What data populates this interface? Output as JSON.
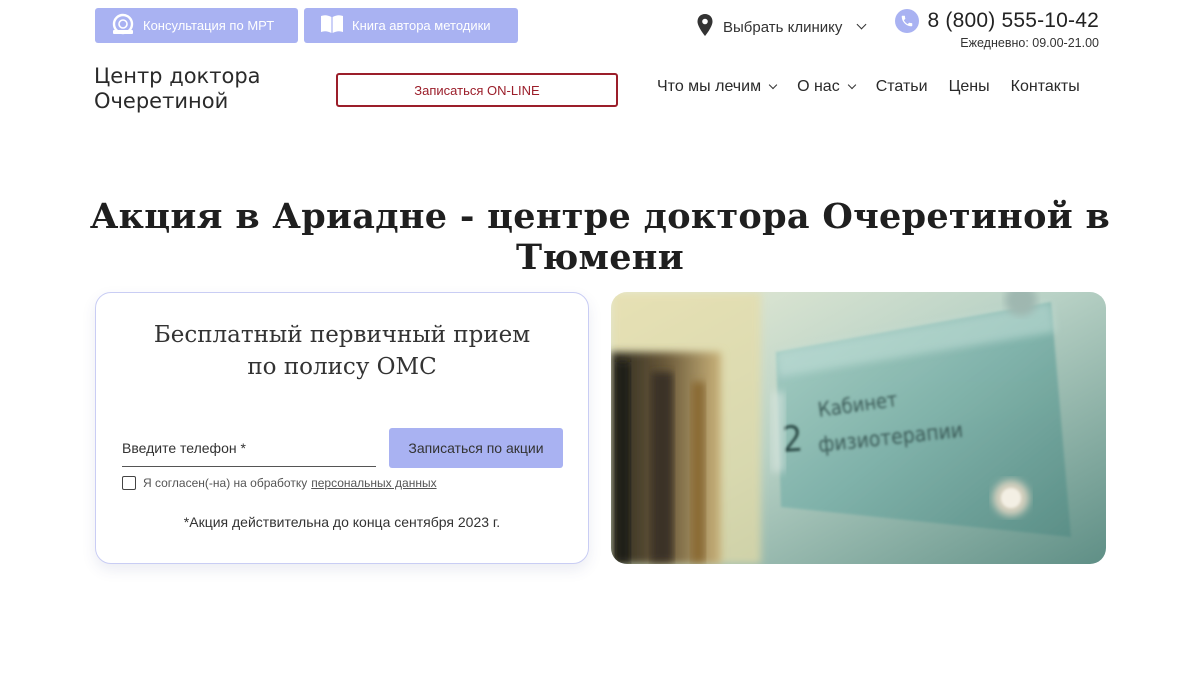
{
  "top_links": {
    "mri_label": "Консультация по МРТ",
    "book_label": "Книга автора методики"
  },
  "clinic_select": {
    "label": "Выбрать клинику"
  },
  "contact": {
    "phone": "8 (800) 555-10-42",
    "hours": "Ежедневно: 09.00-21.00"
  },
  "logo": {
    "line1": "Центр доктора",
    "line2": "Очеретиной"
  },
  "online_button": {
    "label": "Записаться ON-LINE"
  },
  "nav": {
    "items": [
      {
        "label": "Что мы лечим",
        "has_dropdown": true
      },
      {
        "label": "О нас",
        "has_dropdown": true
      },
      {
        "label": "Статьи",
        "has_dropdown": false
      },
      {
        "label": "Цены",
        "has_dropdown": false
      },
      {
        "label": "Контакты",
        "has_dropdown": false
      }
    ]
  },
  "headline": "Акция в Ариадне - центре доктора Очеретиной в Тюмени",
  "form": {
    "title_line1": "Бесплатный первичный прием",
    "title_line2": "по полису ОМС",
    "phone_placeholder": "Введите телефон *",
    "submit_label": "Записаться по акции",
    "consent_text": "Я согласен(-на) на обработку",
    "consent_link": "персональных данных",
    "consent_checked": false,
    "promo_note": "*Акция действительна до конца сентября 2023 г."
  },
  "photo": {
    "sign_number": "2",
    "sign_line1": "Кабинет",
    "sign_line2": "физиотерапии"
  },
  "colors": {
    "accent": "#a9b2f2",
    "brand_red": "#9b1e2a",
    "text": "#222222",
    "card_border": "#c9cdf4"
  },
  "icons": {
    "mri": "mri-scanner-icon",
    "book": "open-book-icon",
    "location": "map-pin-icon",
    "phone": "phone-icon"
  }
}
